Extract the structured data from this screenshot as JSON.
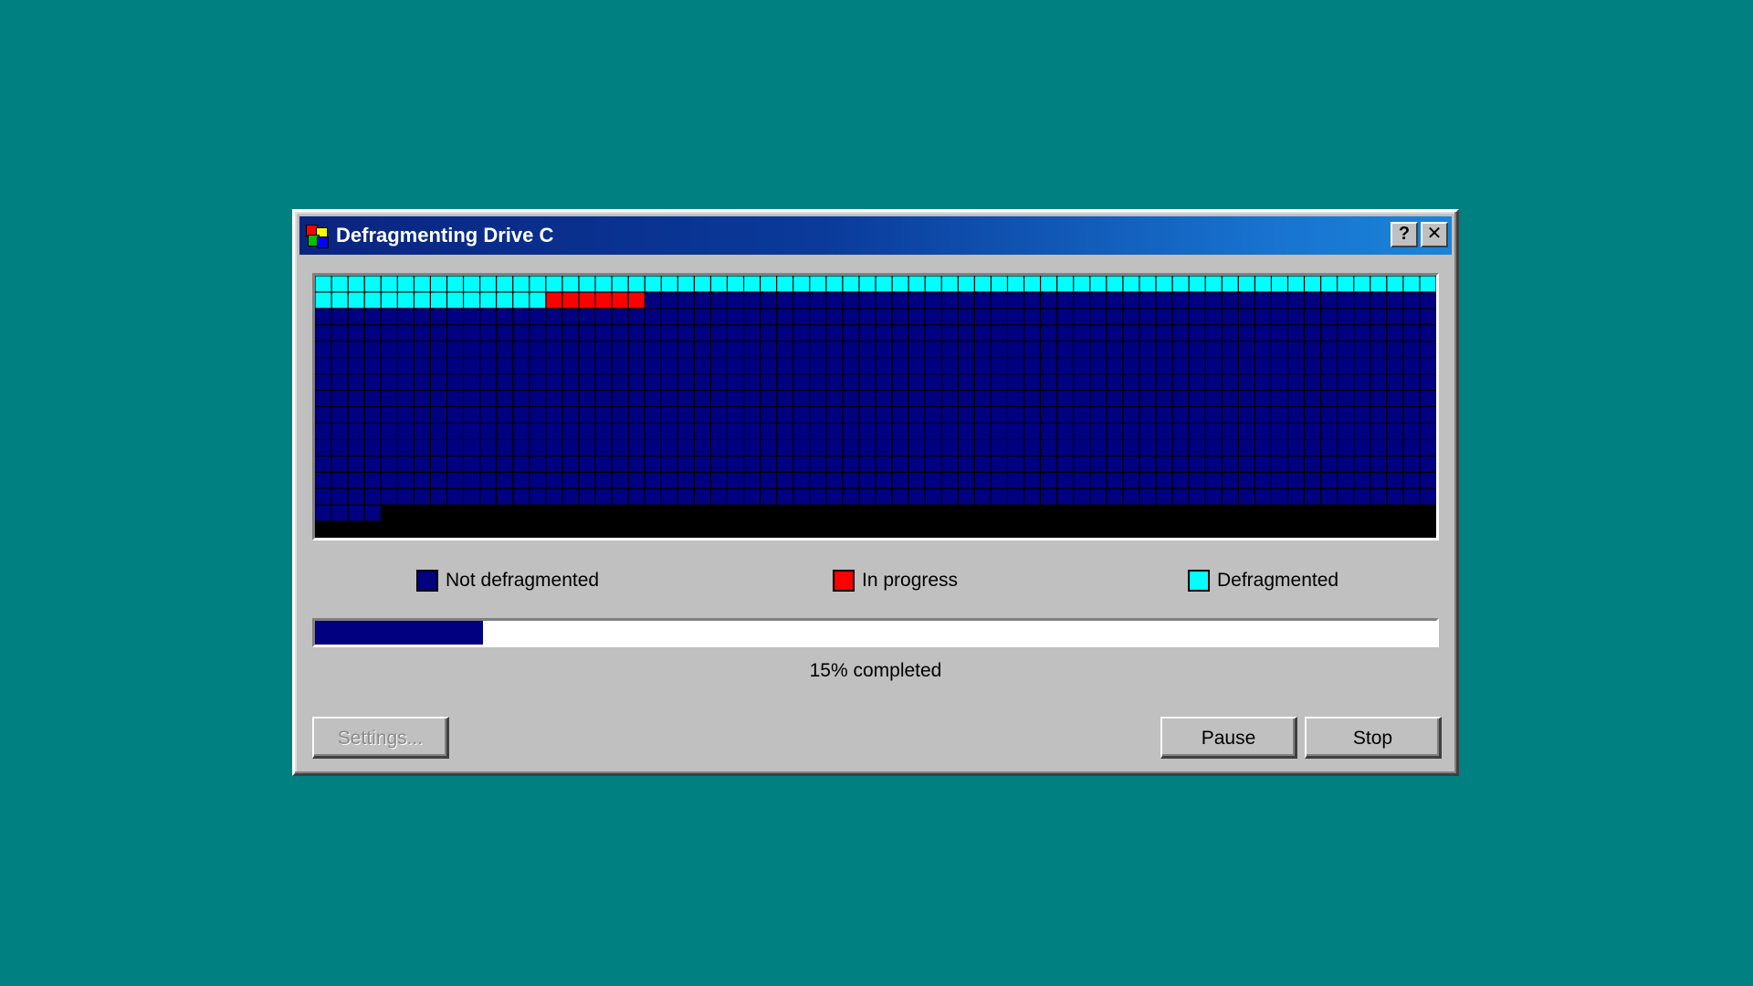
{
  "window": {
    "title": "Defragmenting Drive C",
    "help_label": "?",
    "close_label": "✕"
  },
  "colors": {
    "desktop": "#008080",
    "not_defragmented": "#000080",
    "in_progress": "#ff0000",
    "defragmented": "#00ffff",
    "unused": "#000000"
  },
  "cluster_map": {
    "columns": 68,
    "rows": 16,
    "defragmented_blocks": 82,
    "in_progress_blocks": 6,
    "total_used_blocks": 956
  },
  "legend": [
    {
      "label": "Not defragmented",
      "color": "#000080"
    },
    {
      "label": "In progress",
      "color": "#ff0000"
    },
    {
      "label": "Defragmented",
      "color": "#00ffff"
    }
  ],
  "progress": {
    "percent": 15,
    "text": "15% completed"
  },
  "buttons": {
    "settings": "Settings...",
    "pause": "Pause",
    "stop": "Stop"
  }
}
